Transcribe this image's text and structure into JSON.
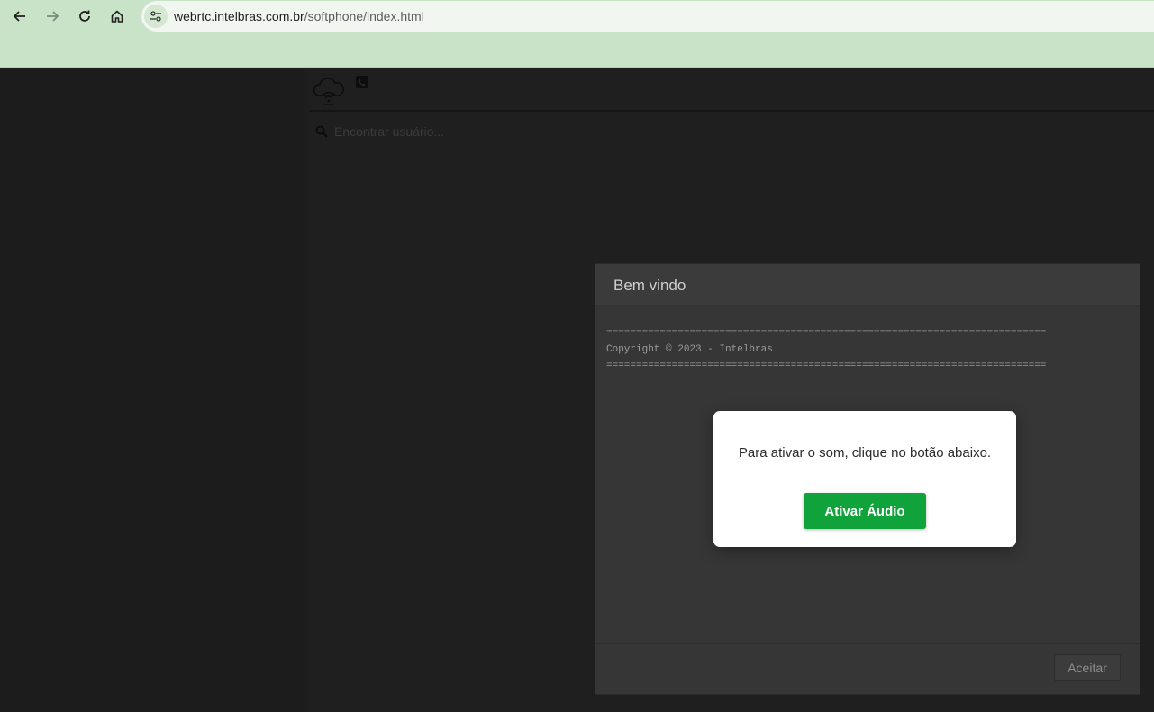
{
  "browser": {
    "url_domain": "webrtc.intelbras.com.br",
    "url_path": "/softphone/index.html",
    "icons": [
      "back-arrow-icon",
      "forward-arrow-icon",
      "reload-icon",
      "home-icon",
      "site-settings-icon"
    ],
    "chrome_color": "#c8e3c8"
  },
  "app": {
    "search": {
      "placeholder": "Encontrar usuário..."
    },
    "icons": [
      "cloud-wifi-logo-icon",
      "phone-icon",
      "search-icon"
    ]
  },
  "welcome_modal": {
    "title": "Bem vindo",
    "body": "==========================================================================\nCopyright © 2023 - Intelbras\n==========================================================================",
    "accept_label": "Aceitar"
  },
  "audio_dialog": {
    "message": "Para ativar o som, clique no botão abaixo.",
    "button_label": "Ativar Áudio",
    "button_color": "#10a33b"
  }
}
